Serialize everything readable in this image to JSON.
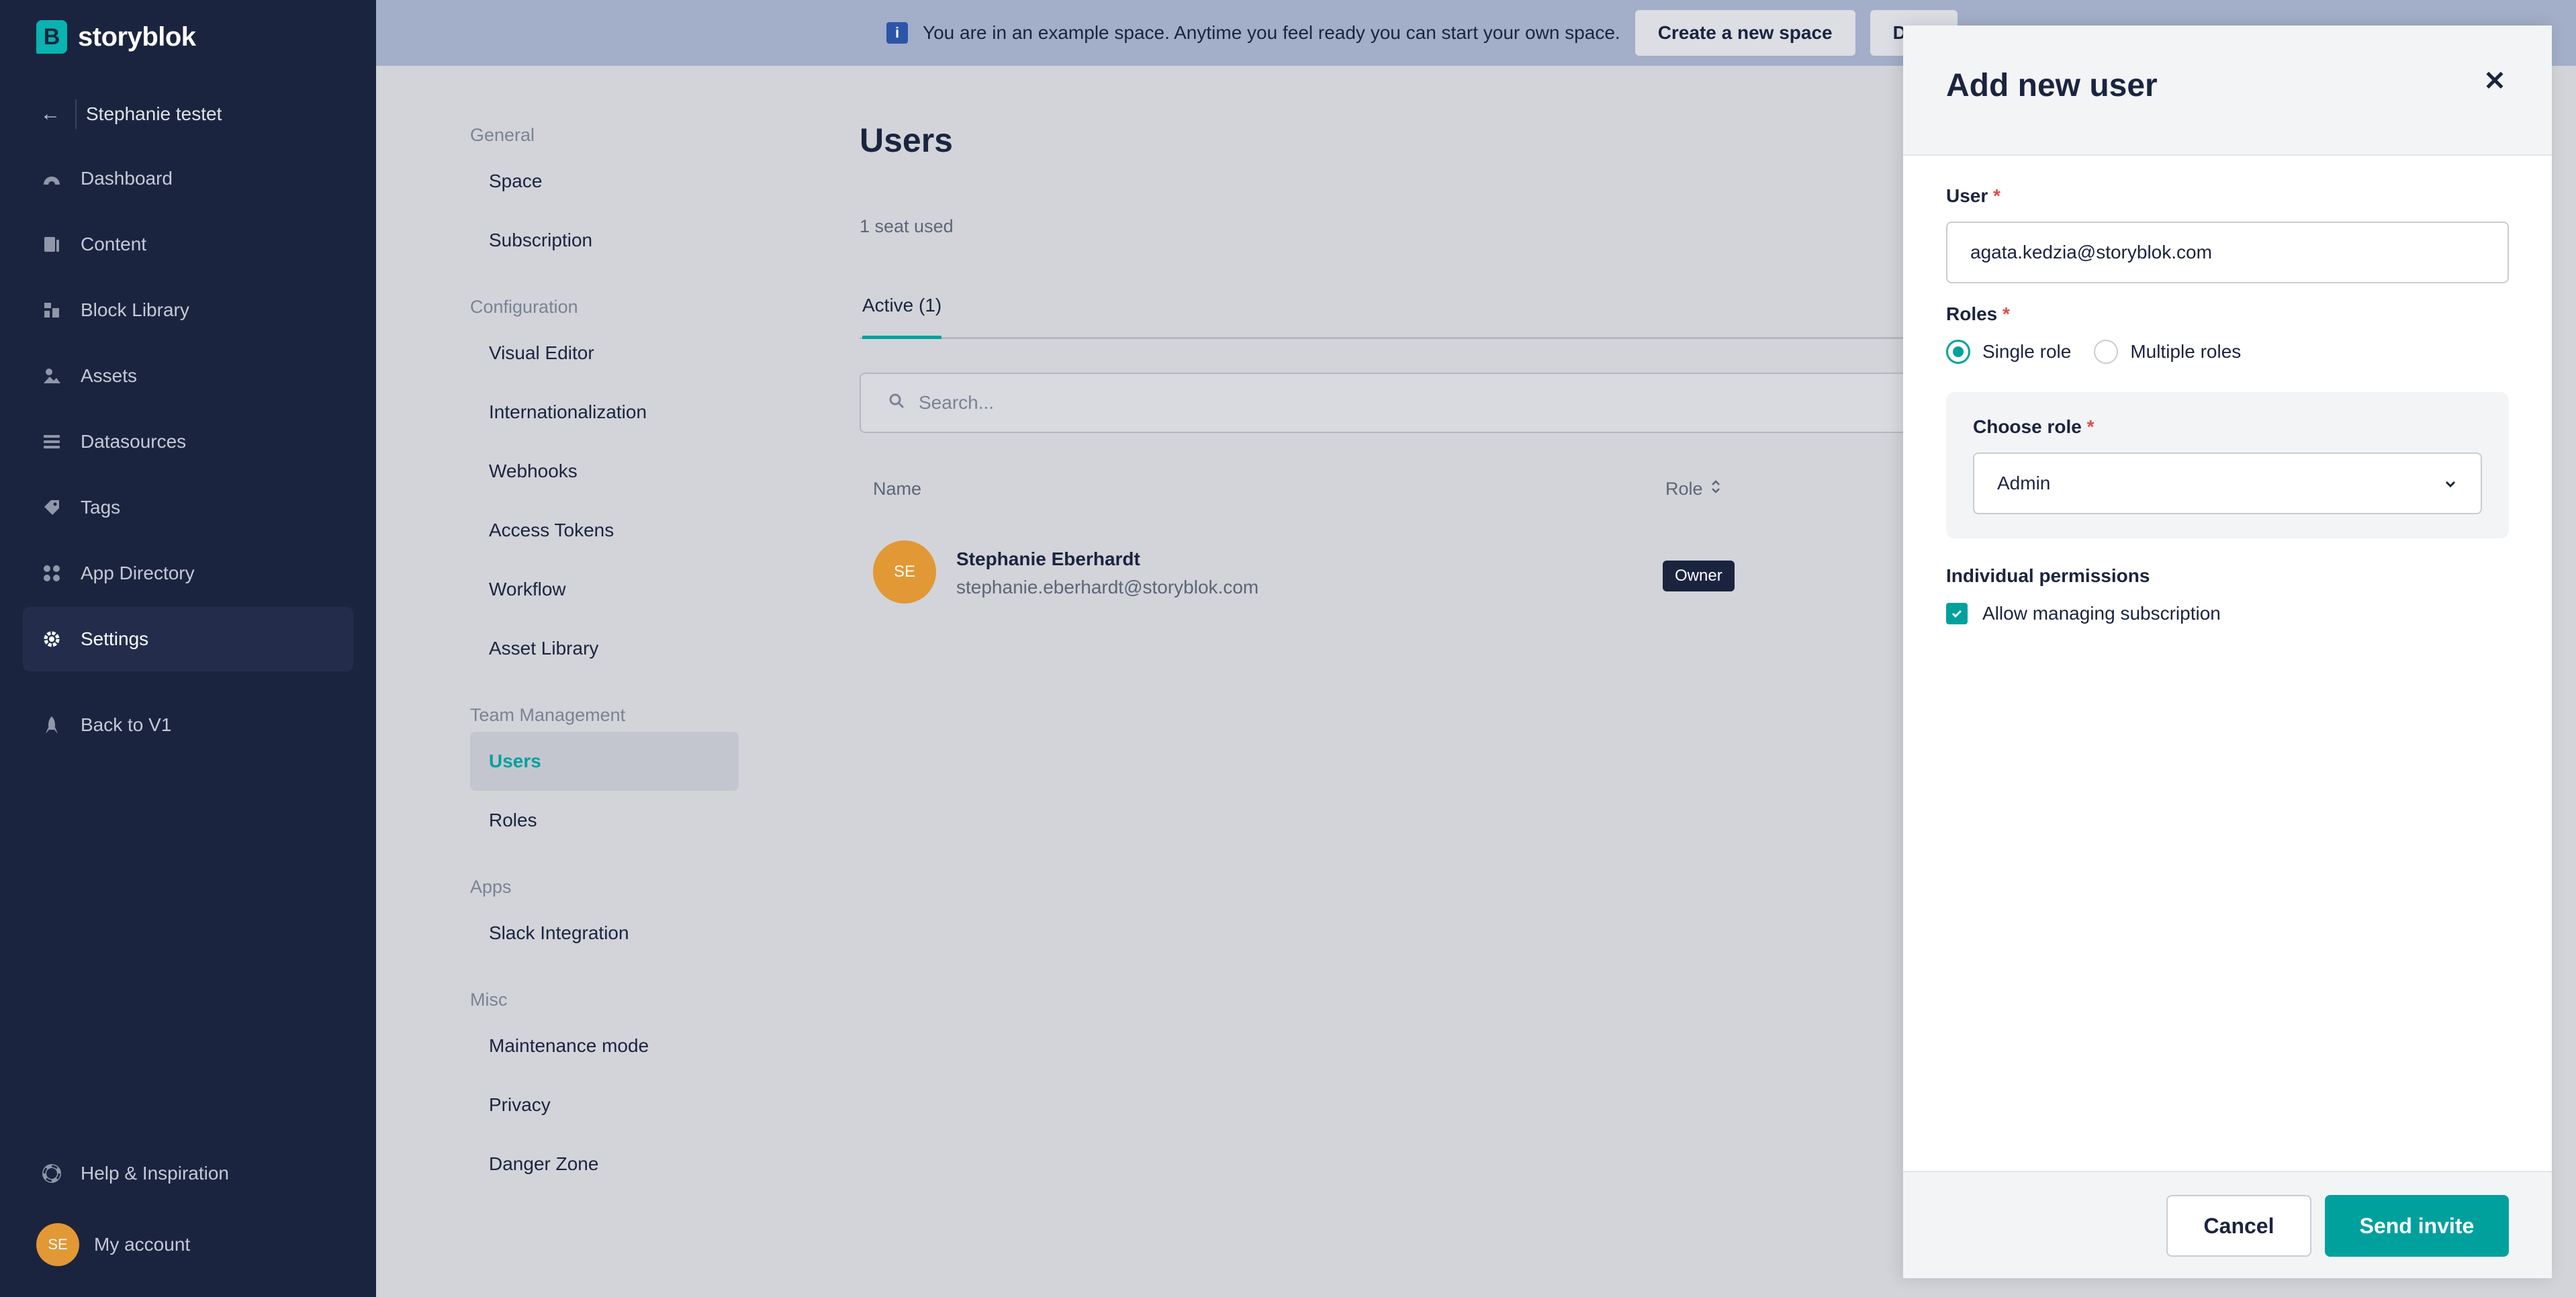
{
  "brand": {
    "name": "storyblok",
    "mark": "B",
    "accent": "#09b3af"
  },
  "sidebar": {
    "space_name": "Stephanie testet",
    "items": [
      {
        "label": "Dashboard",
        "icon": "dashboard-icon"
      },
      {
        "label": "Content",
        "icon": "content-icon"
      },
      {
        "label": "Block Library",
        "icon": "block-library-icon"
      },
      {
        "label": "Assets",
        "icon": "assets-icon"
      },
      {
        "label": "Datasources",
        "icon": "datasources-icon"
      },
      {
        "label": "Tags",
        "icon": "tag-icon"
      },
      {
        "label": "App Directory",
        "icon": "apps-icon"
      },
      {
        "label": "Settings",
        "icon": "gear-icon",
        "active": true
      }
    ],
    "back_v1": "Back to V1",
    "help": "Help & Inspiration",
    "account": {
      "label": "My account",
      "initials": "SE"
    }
  },
  "banner": {
    "message": "You are in an example space. Anytime you feel ready you can start your own space.",
    "create_btn": "Create a new space",
    "duplicate_btn": "Dupl"
  },
  "settings_menu": {
    "general": {
      "title": "General",
      "items": [
        "Space",
        "Subscription"
      ]
    },
    "configuration": {
      "title": "Configuration",
      "items": [
        "Visual Editor",
        "Internationalization",
        "Webhooks",
        "Access Tokens",
        "Workflow",
        "Asset Library"
      ]
    },
    "team": {
      "title": "Team Management",
      "items": [
        "Users",
        "Roles"
      ]
    },
    "apps": {
      "title": "Apps",
      "items": [
        "Slack Integration"
      ]
    },
    "misc": {
      "title": "Misc",
      "items": [
        "Maintenance mode",
        "Privacy",
        "Danger Zone"
      ]
    }
  },
  "main": {
    "title": "Users",
    "seats": "1 seat used",
    "tab_active": "Active (1)",
    "search_placeholder": "Search...",
    "columns": {
      "name": "Name",
      "role": "Role"
    },
    "user": {
      "initials": "SE",
      "name": "Stephanie Eberhardt",
      "email": "stephanie.eberhardt@storyblok.com",
      "role": "Owner"
    }
  },
  "modal": {
    "title": "Add new user",
    "user_label": "User",
    "user_value": "agata.kedzia@storyblok.com",
    "roles_label": "Roles",
    "single_role": "Single role",
    "multiple_roles": "Multiple roles",
    "choose_role_label": "Choose role",
    "role_value": "Admin",
    "permissions_label": "Individual permissions",
    "permission_item": "Allow managing subscription",
    "required_mark": "*",
    "cancel": "Cancel",
    "send": "Send invite"
  }
}
